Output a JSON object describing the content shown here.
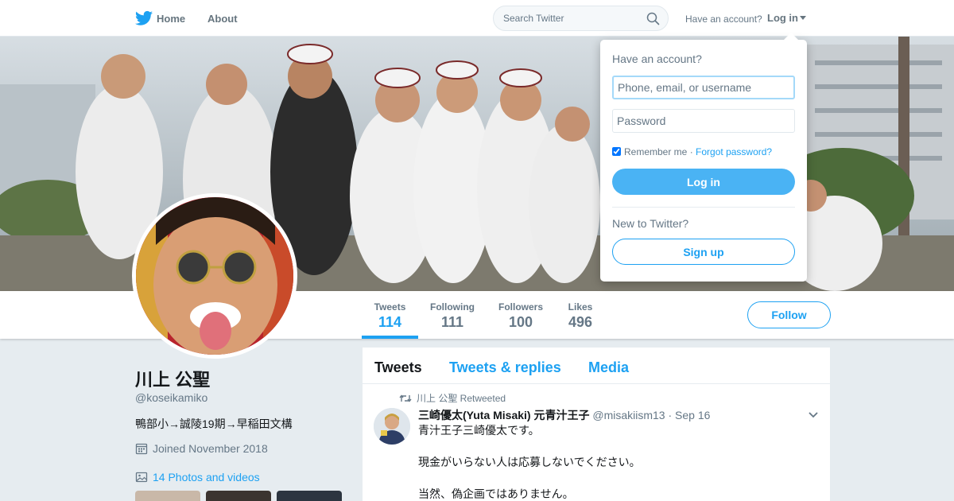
{
  "nav": {
    "home_label": "Home",
    "about_label": "About",
    "search_placeholder": "Search Twitter",
    "have_account_text": "Have an account?",
    "login_label": "Log in"
  },
  "profile": {
    "display_name": "川上 公聖",
    "handle": "@koseikamiko",
    "bio": "鴨部小→誠陵19期→早稲田文構",
    "joined": "Joined November 2018",
    "photos_link": "14 Photos and videos"
  },
  "stats": [
    {
      "label": "Tweets",
      "value": "114"
    },
    {
      "label": "Following",
      "value": "111"
    },
    {
      "label": "Followers",
      "value": "100"
    },
    {
      "label": "Likes",
      "value": "496"
    }
  ],
  "follow_label": "Follow",
  "timeline": {
    "tabs": [
      "Tweets",
      "Tweets & replies",
      "Media"
    ],
    "tweet": {
      "retweet_context": "川上 公聖 Retweeted",
      "display_name": "三崎優太(Yuta Misaki) 元青汁王子",
      "username": "@misakiism13",
      "separator": "·",
      "date": "Sep 16",
      "lines": [
        "青汁王子三崎優太です。",
        "現金がいらない人は応募しないでください。",
        "当然、偽企画ではありません。"
      ]
    }
  },
  "login_dropdown": {
    "title": "Have an account?",
    "username_placeholder": "Phone, email, or username",
    "password_placeholder": "Password",
    "remember_label": "Remember me",
    "separator": "·",
    "forgot_label": "Forgot password?",
    "login_button": "Log in",
    "new_text": "New to Twitter?",
    "signup_button": "Sign up"
  },
  "colors": {
    "accent": "#1da1f2",
    "login_button": "#4ab3f4",
    "background": "#e6ecf0"
  },
  "icons": [
    "twitter-bird-icon",
    "search-icon",
    "calendar-icon",
    "photo-icon",
    "retweet-icon",
    "chevron-down-icon"
  ]
}
